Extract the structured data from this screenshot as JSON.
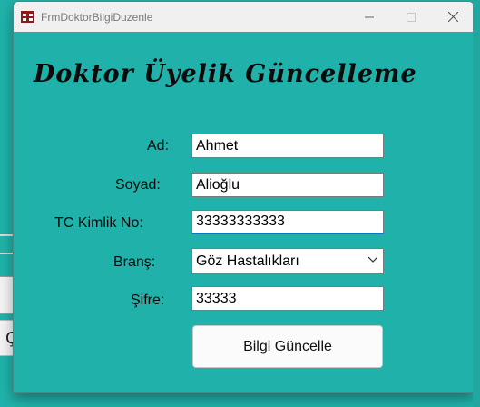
{
  "window": {
    "title": "FrmDoktorBilgiDuzenle",
    "icon": "app-form-icon"
  },
  "heading": "Doktor Üyelik Güncelleme",
  "form": {
    "ad_label": "Ad:",
    "ad_value": "Ahmet",
    "soyad_label": "Soyad:",
    "soyad_value": "Alioğlu",
    "tc_label": "TC Kimlik No:",
    "tc_value": "33333333333",
    "brans_label": "Branş:",
    "brans_value": "Göz Hastalıkları",
    "sifre_label": "Şifre:",
    "sifre_value": "33333",
    "submit_label": "Bilgi Güncelle"
  },
  "background": {
    "chip_text": "Ç"
  },
  "colors": {
    "form_background": "#20b2aa",
    "titlebar": "#f0f0f0",
    "focus_accent": "#1d6fbf"
  }
}
